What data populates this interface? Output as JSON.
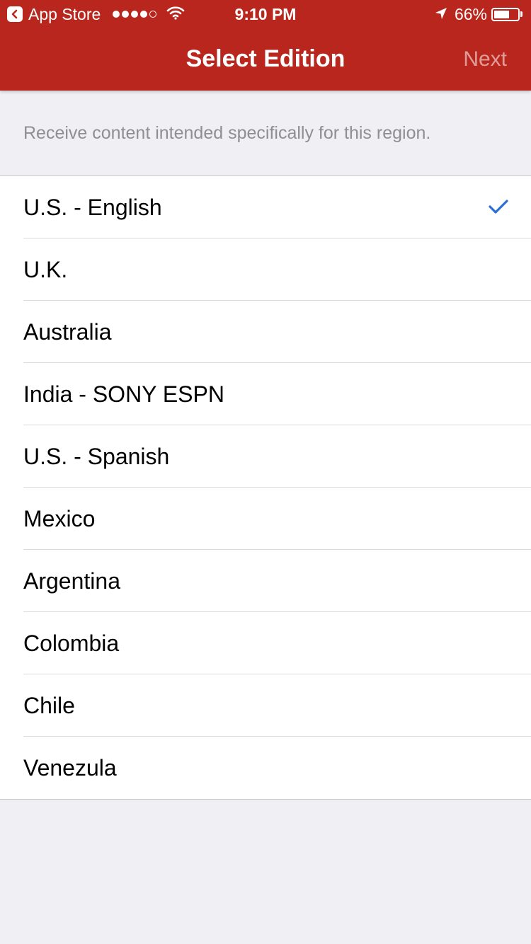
{
  "status_bar": {
    "back_app": "App Store",
    "signal_bars": 5,
    "signal_filled": 4,
    "time": "9:10 PM",
    "battery_percent": "66%",
    "battery_level": 0.66
  },
  "nav": {
    "title": "Select Edition",
    "next_label": "Next"
  },
  "caption": "Receive content intended specifically for this region.",
  "editions": [
    {
      "label": "U.S. - English",
      "selected": true
    },
    {
      "label": "U.K.",
      "selected": false
    },
    {
      "label": "Australia",
      "selected": false
    },
    {
      "label": "India - SONY ESPN",
      "selected": false
    },
    {
      "label": "U.S. - Spanish",
      "selected": false
    },
    {
      "label": "Mexico",
      "selected": false
    },
    {
      "label": "Argentina",
      "selected": false
    },
    {
      "label": "Colombia",
      "selected": false
    },
    {
      "label": "Chile",
      "selected": false
    },
    {
      "label": "Venezula",
      "selected": false
    }
  ],
  "colors": {
    "header_red": "#b8261d",
    "checkmark_blue": "#2b6fd6",
    "background_gray": "#efeff4"
  },
  "icons": {
    "back": "back-chevron-icon",
    "wifi": "wifi-icon",
    "location": "location-arrow-icon",
    "battery": "battery-icon",
    "selected": "checkmark-icon"
  }
}
